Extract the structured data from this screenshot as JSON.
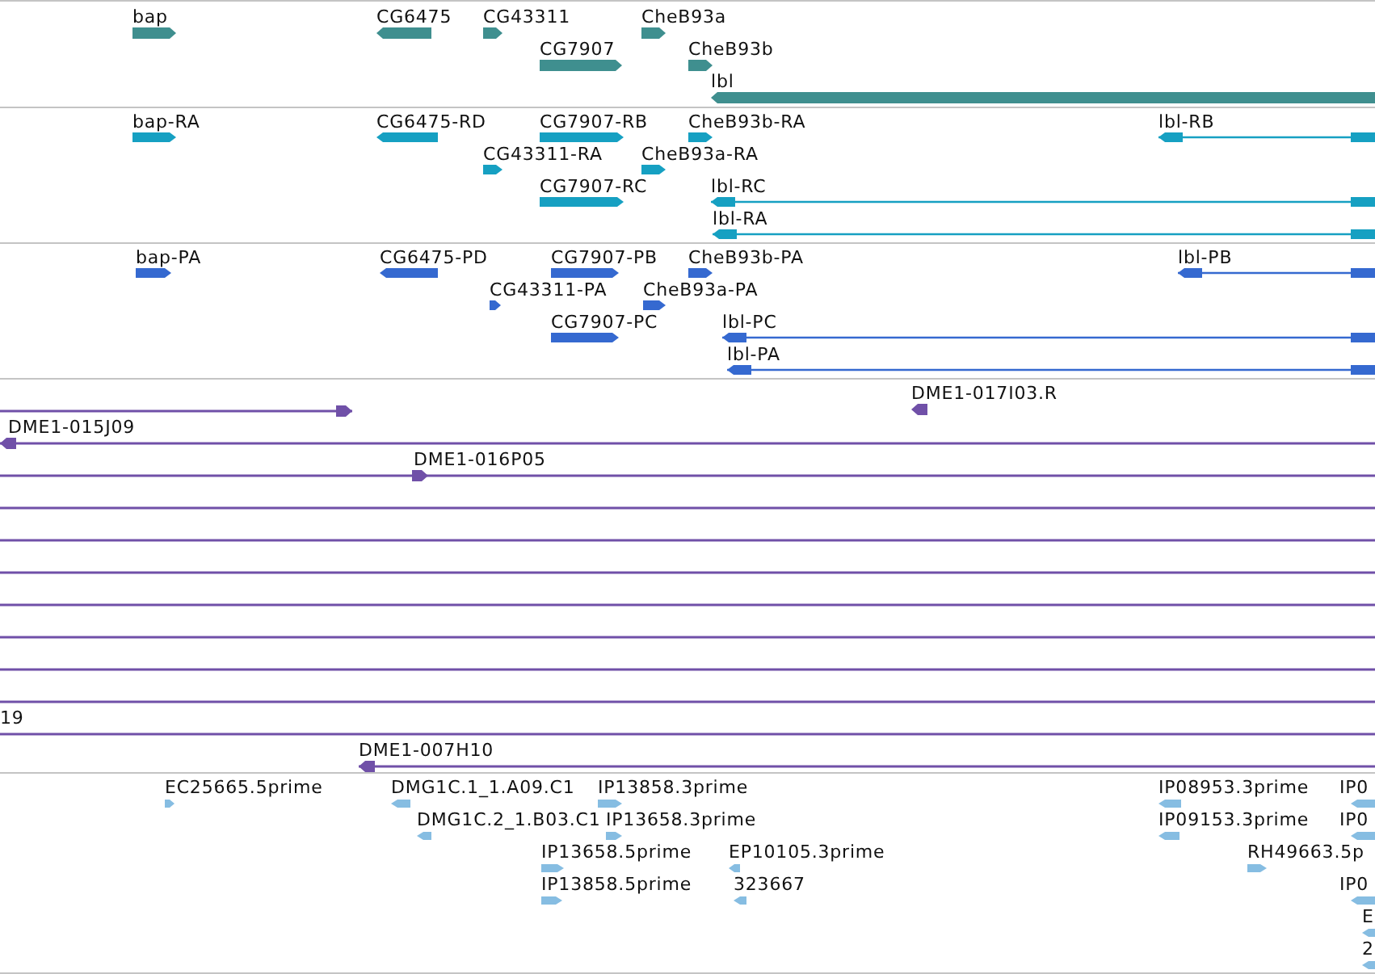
{
  "tracks": [
    {
      "kind": "gene",
      "features": [
        {
          "label": "bap",
          "reverse": false
        },
        {
          "label": "CG6475",
          "reverse": true
        },
        {
          "label": "CG43311",
          "reverse": false
        },
        {
          "label": "CheB93a",
          "reverse": false
        },
        {
          "label": "CG7907",
          "reverse": false
        },
        {
          "label": "CheB93b",
          "reverse": false
        },
        {
          "label": "lbl",
          "reverse": true
        }
      ]
    },
    {
      "kind": "transcript",
      "features": [
        {
          "label": "bap-RA",
          "reverse": false
        },
        {
          "label": "CG6475-RD",
          "reverse": true
        },
        {
          "label": "CG7907-RB",
          "reverse": false
        },
        {
          "label": "CheB93b-RA",
          "reverse": false
        },
        {
          "label": "lbl-RB",
          "reverse": true
        },
        {
          "label": "CG43311-RA",
          "reverse": false
        },
        {
          "label": "CheB93a-RA",
          "reverse": false
        },
        {
          "label": "CG7907-RC",
          "reverse": false
        },
        {
          "label": "lbl-RC",
          "reverse": true
        },
        {
          "label": "lbl-RA",
          "reverse": true
        }
      ]
    },
    {
      "kind": "protein",
      "features": [
        {
          "label": "bap-PA",
          "reverse": false
        },
        {
          "label": "CG6475-PD",
          "reverse": true
        },
        {
          "label": "CG7907-PB",
          "reverse": false
        },
        {
          "label": "CheB93b-PA",
          "reverse": false
        },
        {
          "label": "lbl-PB",
          "reverse": true
        },
        {
          "label": "CG43311-PA",
          "reverse": false
        },
        {
          "label": "CheB93a-PA",
          "reverse": false
        },
        {
          "label": "CG7907-PC",
          "reverse": false
        },
        {
          "label": "lbl-PC",
          "reverse": true
        },
        {
          "label": "lbl-PA",
          "reverse": true
        }
      ]
    },
    {
      "kind": "clone",
      "features": [
        {
          "label": "DME1-017I03.R",
          "forward": false,
          "reverse": true
        },
        {
          "forward": true,
          "reverse": false
        },
        {
          "label": "DME1-015J09",
          "forward": false,
          "reverse": true
        },
        {
          "label": "DME1-016P05",
          "forward": true,
          "reverse": false
        },
        {
          "forward": false,
          "reverse": false
        },
        {
          "forward": false,
          "reverse": false
        },
        {
          "forward": false,
          "reverse": false
        },
        {
          "forward": false,
          "reverse": false
        },
        {
          "forward": false,
          "reverse": false
        },
        {
          "forward": false,
          "reverse": false
        },
        {
          "forward": false,
          "reverse": false
        },
        {
          "label": "19",
          "forward": false,
          "reverse": false
        },
        {
          "label": "DME1-007H10",
          "forward": false,
          "reverse": true
        }
      ]
    },
    {
      "kind": "est",
      "features": [
        {
          "label": "EC25665.5prime",
          "reverse": false
        },
        {
          "label": "DMG1C.1_1.A09.C1",
          "reverse": true
        },
        {
          "label": "IP13858.3prime",
          "reverse": false
        },
        {
          "label": "IP08953.3prime",
          "reverse": true
        },
        {
          "label": "IP0",
          "reverse": true
        },
        {
          "label": "DMG1C.2_1.B03.C1",
          "reverse": true
        },
        {
          "label": "IP13658.3prime",
          "reverse": false
        },
        {
          "label": "IP09153.3prime",
          "reverse": true
        },
        {
          "label": "IP0",
          "reverse": true
        },
        {
          "label": "IP13658.5prime",
          "reverse": false
        },
        {
          "label": "EP10105.3prime",
          "reverse": true
        },
        {
          "label": "RH49663.5p",
          "reverse": false
        },
        {
          "label": "IP13858.5prime",
          "reverse": false
        },
        {
          "label": "323667",
          "reverse": true
        },
        {
          "label": "IP0",
          "reverse": true
        },
        {
          "label": "E",
          "reverse": true
        },
        {
          "label": "2",
          "reverse": true
        }
      ]
    }
  ]
}
